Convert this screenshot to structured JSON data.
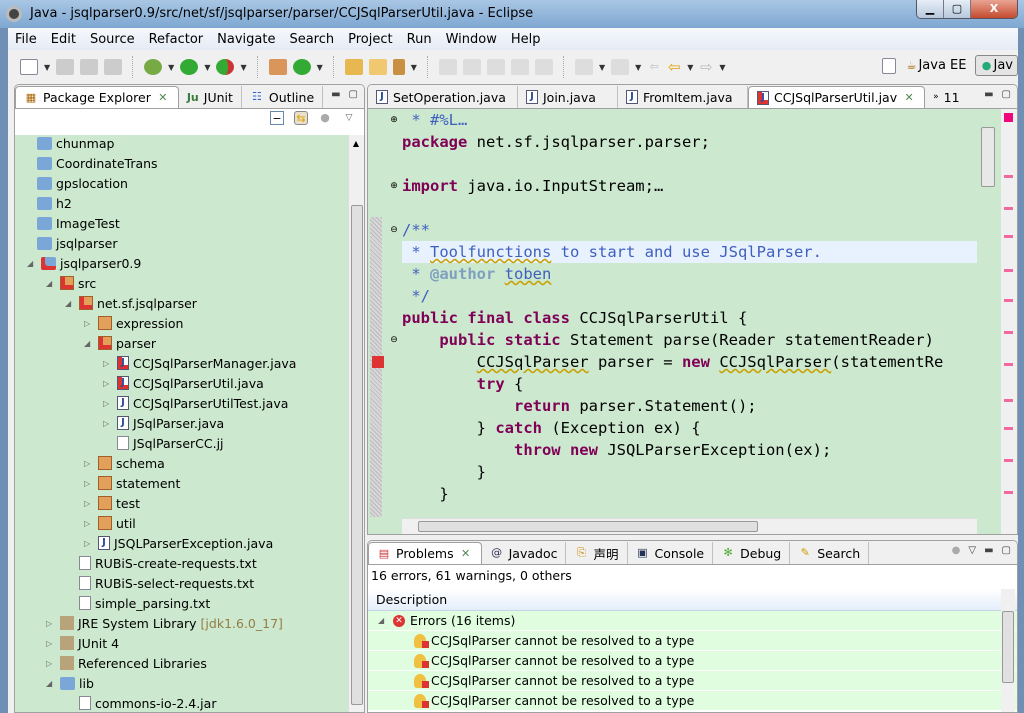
{
  "window": {
    "title": "Java - jsqlparser0.9/src/net/sf/jsqlparser/parser/CCJSqlParserUtil.java - Eclipse",
    "min": "▁",
    "max": "▢",
    "close": "X"
  },
  "menu": [
    "File",
    "Edit",
    "Source",
    "Refactor",
    "Navigate",
    "Search",
    "Project",
    "Run",
    "Window",
    "Help"
  ],
  "perspectives": {
    "java_ee": "Java EE",
    "java": "Jav"
  },
  "left_tabs": {
    "package_explorer": "Package Explorer",
    "junit": "JUnit",
    "outline": "Outline"
  },
  "tree": [
    {
      "label": "chunmap",
      "level": 0,
      "icon": "folder",
      "arrow": ""
    },
    {
      "label": "CoordinateTrans",
      "level": 0,
      "icon": "folder",
      "arrow": ""
    },
    {
      "label": "gpslocation",
      "level": 0,
      "icon": "folder",
      "arrow": ""
    },
    {
      "label": "h2",
      "level": 0,
      "icon": "folder",
      "arrow": ""
    },
    {
      "label": "ImageTest",
      "level": 0,
      "icon": "folder",
      "arrow": ""
    },
    {
      "label": "jsqlparser",
      "level": 0,
      "icon": "folder",
      "arrow": ""
    },
    {
      "label": "jsqlparser0.9",
      "level": 0,
      "icon": "project",
      "arrow": "open",
      "err": true
    },
    {
      "label": "src",
      "level": 1,
      "icon": "pkg",
      "arrow": "open",
      "err": true
    },
    {
      "label": "net.sf.jsqlparser",
      "level": 2,
      "icon": "pkg",
      "arrow": "open",
      "err": true
    },
    {
      "label": "expression",
      "level": 3,
      "icon": "pkg",
      "arrow": "closed"
    },
    {
      "label": "parser",
      "level": 3,
      "icon": "pkg",
      "arrow": "open",
      "err": true
    },
    {
      "label": "CCJSqlParserManager.java",
      "level": 4,
      "icon": "java",
      "arrow": "closed",
      "err": true
    },
    {
      "label": "CCJSqlParserUtil.java",
      "level": 4,
      "icon": "java",
      "arrow": "closed",
      "err": true
    },
    {
      "label": "CCJSqlParserUtilTest.java",
      "level": 4,
      "icon": "java",
      "arrow": "closed"
    },
    {
      "label": "JSqlParser.java",
      "level": 4,
      "icon": "java",
      "arrow": "closed"
    },
    {
      "label": "JSqlParserCC.jj",
      "level": 4,
      "icon": "text",
      "arrow": ""
    },
    {
      "label": "schema",
      "level": 3,
      "icon": "pkg",
      "arrow": "closed"
    },
    {
      "label": "statement",
      "level": 3,
      "icon": "pkg",
      "arrow": "closed"
    },
    {
      "label": "test",
      "level": 3,
      "icon": "pkg",
      "arrow": "closed"
    },
    {
      "label": "util",
      "level": 3,
      "icon": "pkg",
      "arrow": "closed"
    },
    {
      "label": "JSQLParserException.java",
      "level": 3,
      "icon": "java",
      "arrow": "closed"
    },
    {
      "label": "RUBiS-create-requests.txt",
      "level": 2,
      "icon": "text",
      "arrow": ""
    },
    {
      "label": "RUBiS-select-requests.txt",
      "level": 2,
      "icon": "text",
      "arrow": ""
    },
    {
      "label": "simple_parsing.txt",
      "level": 2,
      "icon": "text",
      "arrow": ""
    },
    {
      "label": "JRE System Library",
      "level": 1,
      "icon": "jar",
      "arrow": "closed",
      "suffix": "[jdk1.6.0_17]"
    },
    {
      "label": "JUnit 4",
      "level": 1,
      "icon": "jar",
      "arrow": "closed"
    },
    {
      "label": "Referenced Libraries",
      "level": 1,
      "icon": "jar",
      "arrow": "closed"
    },
    {
      "label": "lib",
      "level": 1,
      "icon": "folder",
      "arrow": "open"
    },
    {
      "label": "commons-io-2.4.jar",
      "level": 2,
      "icon": "text",
      "arrow": ""
    }
  ],
  "editor_tabs": [
    {
      "label": "SetOperation.java"
    },
    {
      "label": "Join.java"
    },
    {
      "label": "FromItem.java"
    },
    {
      "label": "CCJSqlParserUtil.jav",
      "active": true
    }
  ],
  "editor_overflow": "11",
  "code": [
    [
      [
        " * #%L",
        "cm"
      ],
      [
        "…",
        "cm"
      ]
    ],
    [
      [
        "package",
        "kw"
      ],
      [
        " net.sf.jsqlparser.parser;",
        ""
      ]
    ],
    [
      [
        "",
        ""
      ]
    ],
    [
      [
        "import",
        "kw"
      ],
      [
        " java.io.InputStream;",
        ""
      ],
      [
        "…",
        ""
      ]
    ],
    [
      [
        "",
        ""
      ]
    ],
    [
      [
        "/**",
        "cm"
      ]
    ],
    [
      [
        " * ",
        "cm"
      ],
      [
        "Toolfunctions",
        "cm sq"
      ],
      [
        " to start and use JSqlParser.",
        "cm"
      ]
    ],
    [
      [
        " * ",
        "cm"
      ],
      [
        "@author",
        "tag"
      ],
      [
        " ",
        "cm"
      ],
      [
        "toben",
        "cm sq"
      ]
    ],
    [
      [
        " */",
        "cm"
      ]
    ],
    [
      [
        "public final class",
        "kw"
      ],
      [
        " CCJSqlParserUtil {",
        ""
      ]
    ],
    [
      [
        "    ",
        ""
      ],
      [
        "public static",
        "kw"
      ],
      [
        " Statement parse(Reader statementReader)",
        ""
      ]
    ],
    [
      [
        "        ",
        ""
      ],
      [
        "CCJSqlParser",
        "sq"
      ],
      [
        " parser = ",
        ""
      ],
      [
        "new",
        "kw"
      ],
      [
        " ",
        ""
      ],
      [
        "CCJSqlParser",
        "sq"
      ],
      [
        "(statementRe",
        ""
      ]
    ],
    [
      [
        "        ",
        ""
      ],
      [
        "try",
        "kw"
      ],
      [
        " {",
        ""
      ]
    ],
    [
      [
        "            ",
        ""
      ],
      [
        "return",
        "kw"
      ],
      [
        " parser.Statement();",
        ""
      ]
    ],
    [
      [
        "        } ",
        ""
      ],
      [
        "catch",
        "kw"
      ],
      [
        " (Exception ex) {",
        ""
      ]
    ],
    [
      [
        "            ",
        ""
      ],
      [
        "throw new",
        "kw"
      ],
      [
        " JSQLParserException(ex);",
        ""
      ]
    ],
    [
      [
        "        }",
        ""
      ]
    ],
    [
      [
        "    }",
        ""
      ]
    ]
  ],
  "bottom_tabs": [
    {
      "label": "Problems",
      "active": true
    },
    {
      "label": "Javadoc"
    },
    {
      "label": "声明"
    },
    {
      "label": "Console"
    },
    {
      "label": "Debug"
    },
    {
      "label": "Search"
    }
  ],
  "problems": {
    "summary": "16 errors, 61 warnings, 0 others",
    "column": "Description",
    "group": "Errors (16 items)",
    "items": [
      "CCJSqlParser cannot be resolved to a type",
      "CCJSqlParser cannot be resolved to a type",
      "CCJSqlParser cannot be resolved to a type",
      "CCJSqlParser cannot be resolved to a type"
    ]
  },
  "colors": {
    "editor_bg": "#cce8cf",
    "problems_row": "#e0fde0",
    "error": "#dd3333"
  }
}
